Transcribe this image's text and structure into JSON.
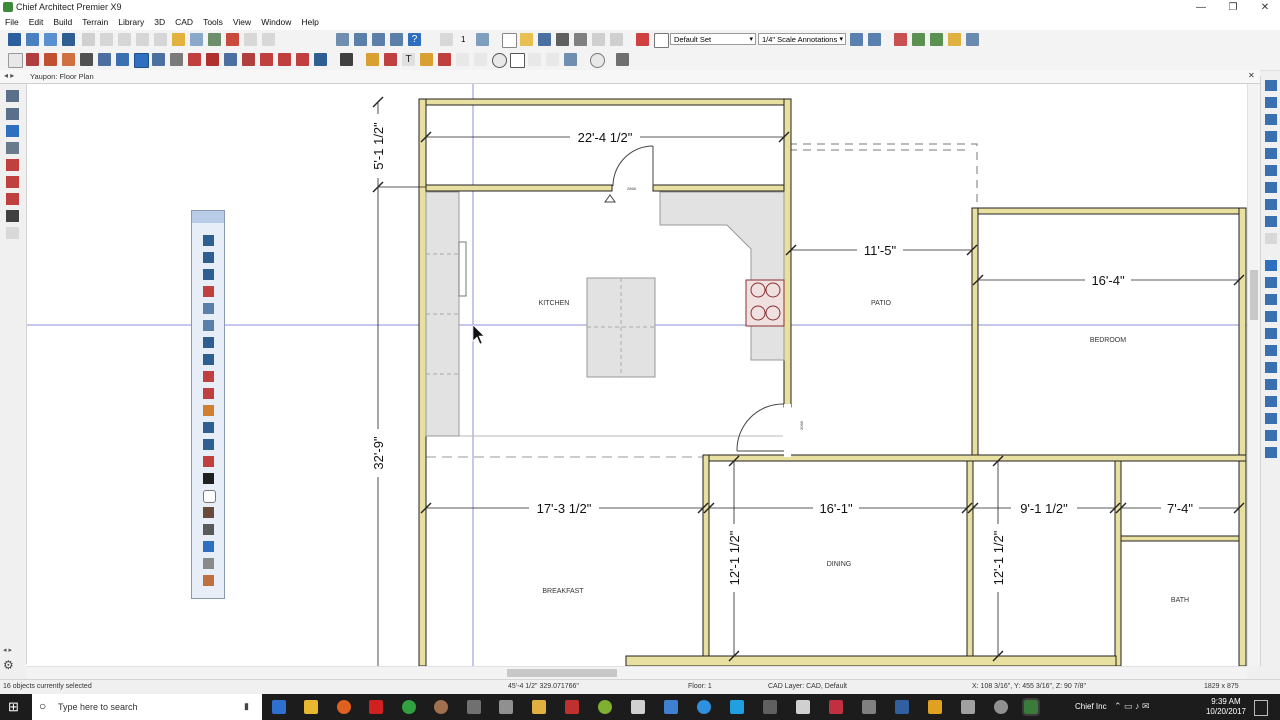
{
  "window": {
    "title": "Chief Architect Premier X9",
    "minimize": "—",
    "restore": "❐",
    "close": "✕"
  },
  "menu": [
    "File",
    "Edit",
    "Build",
    "Terrain",
    "Library",
    "3D",
    "CAD",
    "Tools",
    "View",
    "Window",
    "Help"
  ],
  "toolbar": {
    "layer_set": "Default Set",
    "annotation_set": "1/4\" Scale Annotations",
    "counter": "1"
  },
  "document_tab": {
    "title": "Yaupon: Floor Plan",
    "close": "✕"
  },
  "plan": {
    "rooms": [
      "KITCHEN",
      "PATIO",
      "BEDROOM",
      "BREAKFAST",
      "DINING",
      "BATH"
    ],
    "dimensions": [
      "22'-4 1/2\"",
      "5'-1 1/2\"",
      "11'-5\"",
      "16'-4\"",
      "32'-9\"",
      "17'-3 1/2\"",
      "16'-1\"",
      "9'-1 1/2\"",
      "7'-4\"",
      "12'-1 1/2\"",
      "12'-1 1/2\""
    ],
    "door_labels": [
      "2868",
      "3068"
    ]
  },
  "status": {
    "selection": "16 objects currently selected",
    "coords": "45'-4 1/2\" 329.071766\"",
    "floor": "Floor: 1",
    "cad_layer": "CAD Layer: CAD,  Default",
    "xyz": "X: 108 3/16\", Y: 455 3/16\", Z: 90 7/8\"",
    "size": "1829 x 875"
  },
  "taskbar": {
    "search_placeholder": "Type here to search",
    "user": "Chief Inc",
    "time": "9:39 AM",
    "date": "10/20/2017"
  },
  "colors": {
    "wall_fill": "#e8e0a0",
    "wall_line": "#202020",
    "accent_blue": "#2f6fbf",
    "taskbar": "#1c1c1c"
  }
}
